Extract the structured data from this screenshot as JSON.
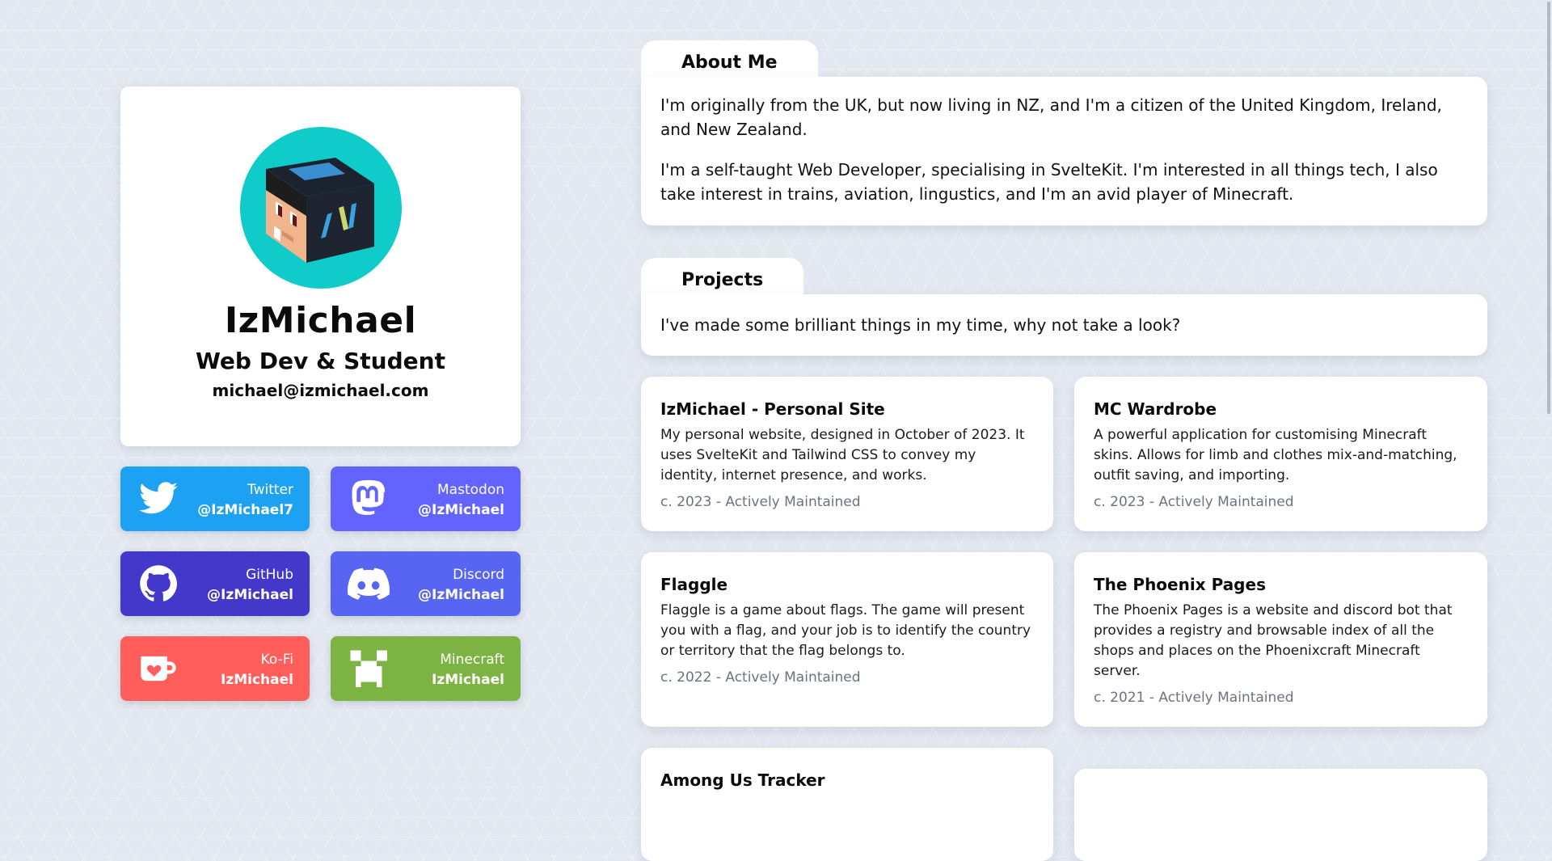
{
  "profile": {
    "name": "IzMichael",
    "role": "Web Dev & Student",
    "email": "michael@izmichael.com",
    "avatar_colors": {
      "background": "#0fcbc9"
    }
  },
  "socials": [
    {
      "label": "Twitter",
      "handle": "@IzMichael7",
      "icon": "twitter-bird-icon",
      "color": "#1da1f2"
    },
    {
      "label": "Mastodon",
      "handle": "@IzMichael",
      "icon": "mastodon-icon",
      "color": "#6364ff"
    },
    {
      "label": "GitHub",
      "handle": "@IzMichael",
      "icon": "github-octocat-icon",
      "color": "#4338ca"
    },
    {
      "label": "Discord",
      "handle": "@IzMichael",
      "icon": "discord-icon",
      "color": "#5865f2"
    },
    {
      "label": "Ko-Fi",
      "handle": "IzMichael",
      "icon": "kofi-cup-icon",
      "color": "#ff5e5b"
    },
    {
      "label": "Minecraft",
      "handle": "IzMichael",
      "icon": "creeper-icon",
      "color": "#7cb342"
    }
  ],
  "about": {
    "tab": "About Me",
    "paragraphs": [
      "I'm originally from the UK, but now living in NZ, and I'm a citizen of the United Kingdom, Ireland, and New Zealand.",
      "I'm a self-taught Web Developer, specialising in SvelteKit. I'm interested in all things tech, I also take interest in trains, aviation, lingustics, and I'm an avid player of Minecraft."
    ]
  },
  "projects": {
    "tab": "Projects",
    "intro": "I've made some brilliant things in my time, why not take a look?",
    "items": [
      {
        "title": "IzMichael - Personal Site",
        "description": "My personal website, designed in October of 2023. It uses SvelteKit and Tailwind CSS to convey my identity, internet presence, and works.",
        "meta": "c. 2023 - Actively Maintained"
      },
      {
        "title": "MC Wardrobe",
        "description": "A powerful application for customising Minecraft skins. Allows for limb and clothes mix-and-matching, outfit saving, and importing.",
        "meta": "c. 2023 - Actively Maintained"
      },
      {
        "title": "Flaggle",
        "description": "Flaggle is a game about flags. The game will present you with a flag, and your job is to identify the country or territory that the flag belongs to.",
        "meta": "c. 2022 - Actively Maintained"
      },
      {
        "title": "The Phoenix Pages",
        "description": "The Phoenix Pages is a website and discord bot that provides a registry and browsable index of all the shops and places on the Phoenixcraft Minecraft server.",
        "meta": "c. 2021 - Actively Maintained"
      },
      {
        "title": "Among Us Tracker",
        "description": "",
        "meta": ""
      },
      {
        "title": "",
        "description": "",
        "meta": ""
      }
    ]
  }
}
